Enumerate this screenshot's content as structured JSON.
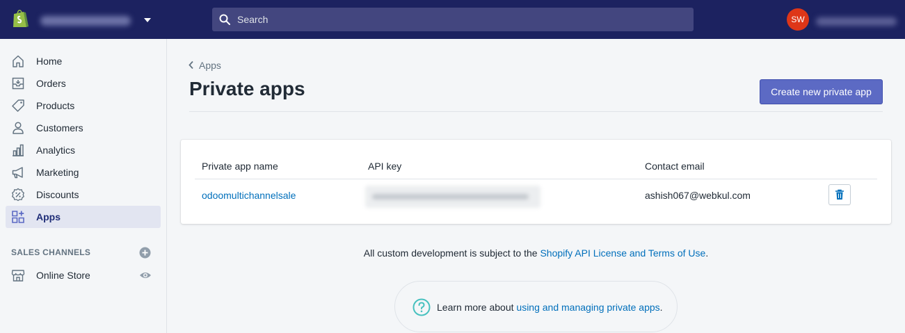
{
  "topbar": {
    "search_placeholder": "Search",
    "avatar_initials": "SW"
  },
  "sidebar": {
    "items": [
      {
        "label": "Home",
        "icon": "home-icon"
      },
      {
        "label": "Orders",
        "icon": "orders-icon"
      },
      {
        "label": "Products",
        "icon": "tag-icon"
      },
      {
        "label": "Customers",
        "icon": "person-icon"
      },
      {
        "label": "Analytics",
        "icon": "bar-chart-icon"
      },
      {
        "label": "Marketing",
        "icon": "megaphone-icon"
      },
      {
        "label": "Discounts",
        "icon": "discount-icon"
      },
      {
        "label": "Apps",
        "icon": "apps-icon",
        "active": true
      }
    ],
    "sales_channels_title": "SALES CHANNELS",
    "channels": [
      {
        "label": "Online Store",
        "icon": "store-icon"
      }
    ]
  },
  "main": {
    "breadcrumb": "Apps",
    "title": "Private apps",
    "create_button": "Create new private app",
    "table": {
      "headers": [
        "Private app name",
        "API key",
        "Contact email"
      ],
      "rows": [
        {
          "name": "odoomultichannelsale",
          "email": "ashish067@webkul.com"
        }
      ]
    },
    "footer": {
      "prefix": "All custom development is subject to the ",
      "link": "Shopify API License and Terms of Use",
      "suffix": "."
    },
    "help": {
      "prefix": "Learn more about ",
      "link": "using and managing private apps",
      "suffix": "."
    }
  },
  "colors": {
    "topbar": "#1c2260",
    "primary": "#5c6ac4",
    "link": "#006fbb",
    "avatar": "#de3618",
    "help_icon": "#47c1bf"
  }
}
